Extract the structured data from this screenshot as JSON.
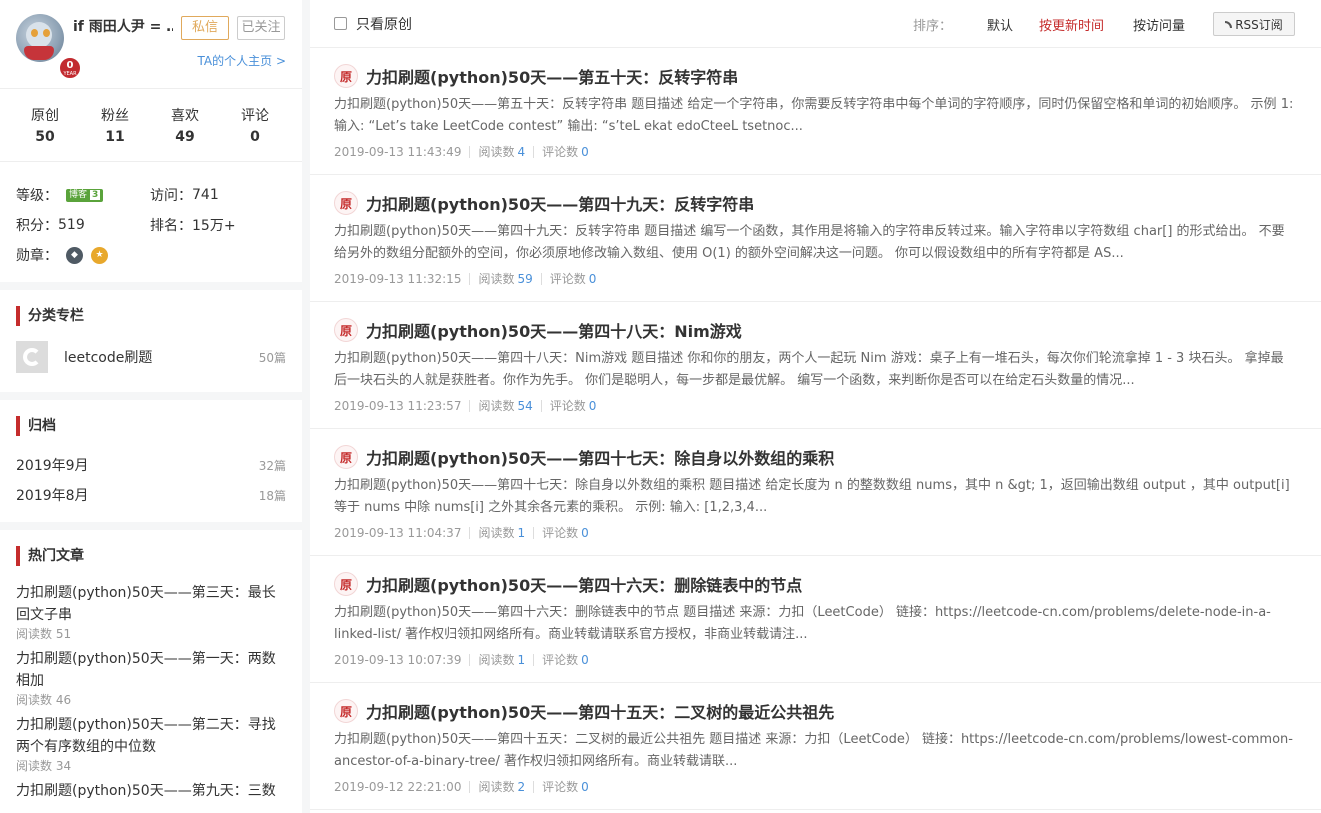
{
  "profile": {
    "username": "if 雨田人尹 = …",
    "year_badge": "0",
    "year_label": "YEAR",
    "message_button": "私信",
    "follow_button": "已关注",
    "homepage_link": "TA的个人主页 >",
    "stats": [
      {
        "label": "原创",
        "value": "50"
      },
      {
        "label": "粉丝",
        "value": "11"
      },
      {
        "label": "喜欢",
        "value": "49"
      },
      {
        "label": "评论",
        "value": "0"
      }
    ],
    "level_label": "等级：",
    "level_badge_text": "博客",
    "level_badge_num": "3",
    "visits_label": "访问：",
    "visits_value": "741",
    "points_label": "积分：",
    "points_value": "519",
    "rank_label": "排名：",
    "rank_value": "15万+",
    "medals_label": "勋章："
  },
  "columns": {
    "title": "分类专栏",
    "items": [
      {
        "name": "leetcode刷题",
        "count": "50篇"
      }
    ]
  },
  "archive": {
    "title": "归档",
    "items": [
      {
        "month": "2019年9月",
        "count": "32篇"
      },
      {
        "month": "2019年8月",
        "count": "18篇"
      }
    ]
  },
  "hot": {
    "title": "热门文章",
    "items": [
      {
        "title": "力扣刷题(python)50天——第三天：最长回文子串",
        "reads": "阅读数 51"
      },
      {
        "title": "力扣刷题(python)50天——第一天：两数相加",
        "reads": "阅读数 46"
      },
      {
        "title": "力扣刷题(python)50天——第二天：寻找两个有序数组的中位数",
        "reads": "阅读数 34"
      },
      {
        "title": "力扣刷题(python)50天——第九天：三数",
        "reads": ""
      }
    ]
  },
  "topbar": {
    "only_original": "只看原创",
    "sort_label": "排序：",
    "sort_default": "默认",
    "sort_newest": "按更新时间",
    "sort_views": "按访问量",
    "rss": "RSS订阅"
  },
  "article_labels": {
    "orig": "原",
    "reads": "阅读数",
    "comments": "评论数"
  },
  "articles": [
    {
      "title": "力扣刷题(python)50天——第五十天：反转字符串",
      "desc": "力扣刷题(python)50天——第五十天：反转字符串 题目描述 给定一个字符串，你需要反转字符串中每个单词的字符顺序，同时仍保留空格和单词的初始顺序。 示例 1: 输入: “Let’s take LeetCode contest” 输出: “s’teL ekat edoCteeL tsetnoc...",
      "date": "2019-09-13 11:43:49",
      "reads": "4",
      "comments": "0"
    },
    {
      "title": "力扣刷题(python)50天——第四十九天：反转字符串",
      "desc": "力扣刷题(python)50天——第四十九天：反转字符串 题目描述 编写一个函数，其作用是将输入的字符串反转过来。输入字符串以字符数组 char[] 的形式给出。 不要给另外的数组分配额外的空间，你必须原地修改输入数组、使用 O(1) 的额外空间解决这一问题。 你可以假设数组中的所有字符都是 AS...",
      "date": "2019-09-13 11:32:15",
      "reads": "59",
      "comments": "0"
    },
    {
      "title": "力扣刷题(python)50天——第四十八天：Nim游戏",
      "desc": "力扣刷题(python)50天——第四十八天：Nim游戏 题目描述 你和你的朋友，两个人一起玩 Nim 游戏：桌子上有一堆石头，每次你们轮流拿掉 1 - 3 块石头。 拿掉最后一块石头的人就是获胜者。你作为先手。 你们是聪明人，每一步都是最优解。 编写一个函数，来判断你是否可以在给定石头数量的情况...",
      "date": "2019-09-13 11:23:57",
      "reads": "54",
      "comments": "0"
    },
    {
      "title": "力扣刷题(python)50天——第四十七天：除自身以外数组的乘积",
      "desc": "力扣刷题(python)50天——第四十七天：除自身以外数组的乘积 题目描述 给定长度为 n 的整数数组 nums，其中 n &gt; 1，返回输出数组 output ，其中 output[i] 等于 nums 中除 nums[i] 之外其余各元素的乘积。 示例: 输入: [1,2,3,4...",
      "date": "2019-09-13 11:04:37",
      "reads": "1",
      "comments": "0"
    },
    {
      "title": "力扣刷题(python)50天——第四十六天：删除链表中的节点",
      "desc": "力扣刷题(python)50天——第四十六天：删除链表中的节点 题目描述 来源：力扣（LeetCode） 链接：https://leetcode-cn.com/problems/delete-node-in-a-linked-list/ 著作权归领扣网络所有。商业转载请联系官方授权，非商业转载请注...",
      "date": "2019-09-13 10:07:39",
      "reads": "1",
      "comments": "0"
    },
    {
      "title": "力扣刷题(python)50天——第四十五天：二叉树的最近公共祖先",
      "desc": "力扣刷题(python)50天——第四十五天：二叉树的最近公共祖先 题目描述 来源：力扣（LeetCode） 链接：https://leetcode-cn.com/problems/lowest-common-ancestor-of-a-binary-tree/ 著作权归领扣网络所有。商业转载请联...",
      "date": "2019-09-12 22:21:00",
      "reads": "2",
      "comments": "0"
    }
  ]
}
